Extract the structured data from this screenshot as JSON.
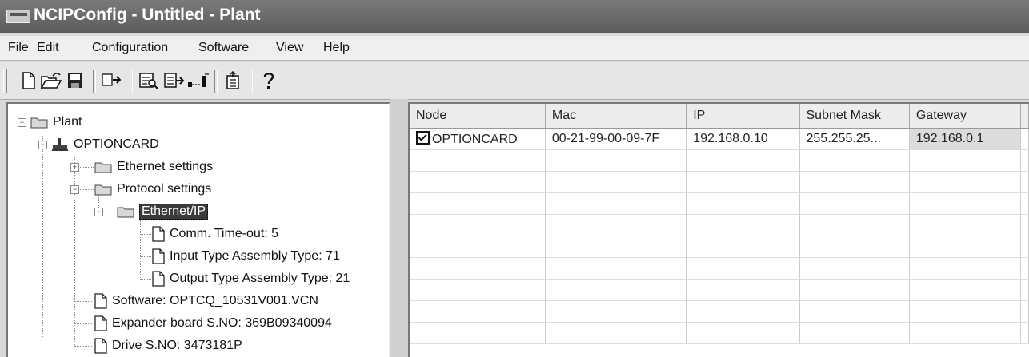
{
  "window": {
    "title": "NCIPConfig - Untitled - Plant"
  },
  "menu": [
    "File",
    "Edit",
    "Configuration",
    "Software",
    "View",
    "Help"
  ],
  "toolbar": {
    "buttons": [
      "new-file-icon",
      "open-folder-icon",
      "save-icon",
      "connect-icon",
      "browse-icon",
      "download-icon",
      "ping-icon",
      "upload-icon",
      "about-icon"
    ]
  },
  "tree": {
    "root": "Plant",
    "device": "OPTIONCARD",
    "ethernet_settings": "Ethernet settings",
    "protocol_settings": "Protocol settings",
    "ethernet_ip": "Ethernet/IP",
    "comm_timeout": "Comm. Time-out: 5",
    "input_type": "Input Type Assembly Type: 71",
    "output_type": "Output Type Assembly Type: 21",
    "software": "Software: OPTCQ_10531V001.VCN",
    "expander": "Expander board S.NO: 369B09340094",
    "drive": "Drive S.NO: 3473181P"
  },
  "grid": {
    "columns": [
      "Node",
      "Mac",
      "IP",
      "Subnet Mask",
      "Gateway"
    ],
    "rows": [
      {
        "node": "OPTIONCARD",
        "checked": true,
        "mac": "00-21-99-00-09-7F",
        "ip": "192.168.0.10",
        "subnet": "255.255.25...",
        "gateway": "192.168.0.1"
      }
    ]
  }
}
